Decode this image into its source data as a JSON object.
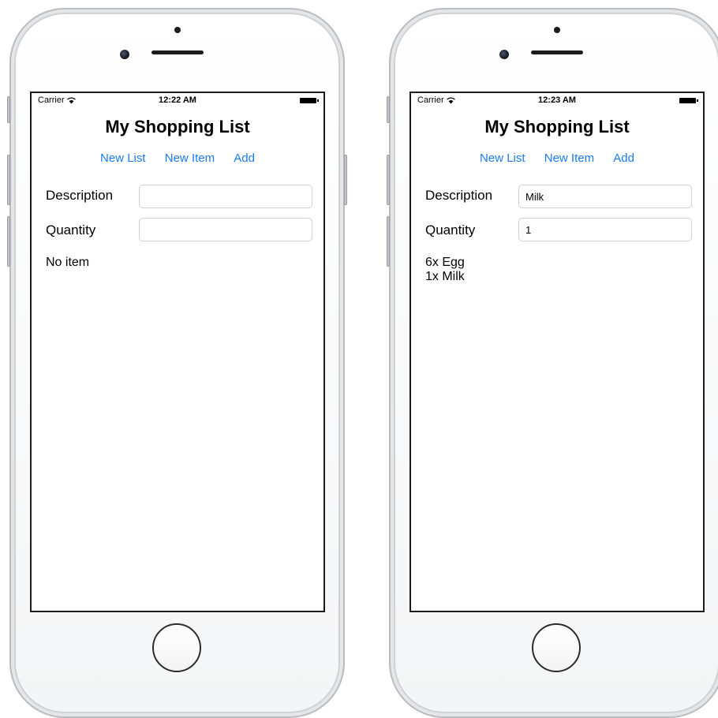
{
  "left_phone": {
    "status": {
      "carrier": "Carrier",
      "time": "12:22 AM"
    },
    "title": "My Shopping List",
    "toolbar": {
      "new_list": "New List",
      "new_item": "New Item",
      "add": "Add"
    },
    "form": {
      "description_label": "Description",
      "description_value": "",
      "quantity_label": "Quantity",
      "quantity_value": ""
    },
    "items": [
      "No item"
    ]
  },
  "right_phone": {
    "status": {
      "carrier": "Carrier",
      "time": "12:23 AM"
    },
    "title": "My Shopping List",
    "toolbar": {
      "new_list": "New List",
      "new_item": "New Item",
      "add": "Add"
    },
    "form": {
      "description_label": "Description",
      "description_value": "Milk",
      "quantity_label": "Quantity",
      "quantity_value": "1"
    },
    "items": [
      "6x Egg",
      "1x Milk"
    ]
  },
  "colors": {
    "accent": "#1a7cf0",
    "text": "#000000",
    "screen_border": "#1c1c1c"
  }
}
